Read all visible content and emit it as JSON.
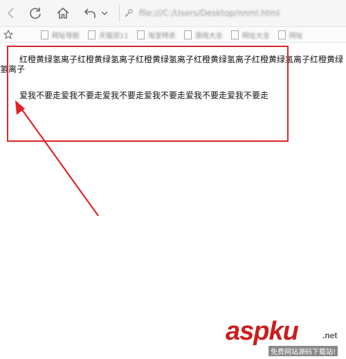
{
  "browser": {
    "address_url": "file:///C:/Users/Desktop/nnml.html",
    "favorites": [
      {
        "label": "网址导航"
      },
      {
        "label": "天猫双11"
      },
      {
        "label": "淘宝特卖"
      },
      {
        "label": "游戏大全"
      },
      {
        "label": "网址大全"
      },
      {
        "label": "网址"
      }
    ]
  },
  "page": {
    "paragraph1": "红橙黄绿氢离子红橙黄绿氢离子红橙黄绿氢离子红橙黄绿氢离子红橙黄绿氢离子红橙黄绿氢离子",
    "paragraph2": "爱我不要走爱我不要走爱我不要走爱我不要走爱我不要走爱我不要走"
  },
  "annotation": {
    "box_color": "#d9262c",
    "arrow_color": "#e0242a"
  },
  "watermark": {
    "brand": "aspku",
    "tld": ".net",
    "tagline": "免费网站源码下载站!"
  }
}
